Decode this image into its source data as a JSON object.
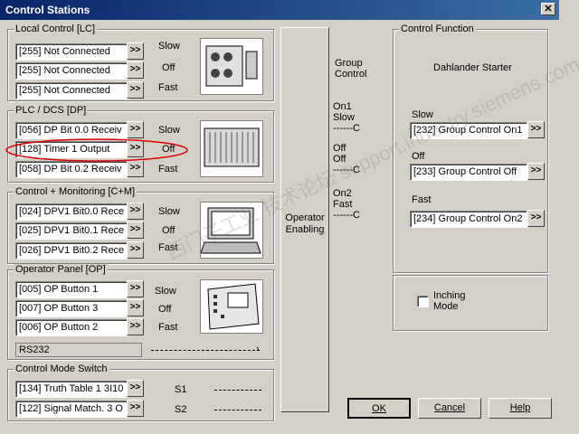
{
  "window": {
    "title": "Control Stations",
    "close": "✕"
  },
  "local": {
    "legend": "Local Control [LC]",
    "fields": [
      "[255] Not Connected",
      "[255] Not Connected",
      "[255] Not Connected"
    ],
    "labels": [
      "Slow",
      "Off",
      "Fast"
    ]
  },
  "plc": {
    "legend": "PLC / DCS [DP]",
    "fields": [
      "[056] DP Bit 0.0 Receiv",
      "[128] Timer 1 Output",
      "[058] DP Bit 0.2 Receiv"
    ],
    "labels": [
      "Slow",
      "Off",
      "Fast"
    ]
  },
  "cm": {
    "legend": "Control + Monitoring [C+M]",
    "fields": [
      "[024] DPV1 Bit0.0 Rece",
      "[025] DPV1 Bit0.1 Rece",
      "[026] DPV1 Bit0.2 Rece"
    ],
    "labels": [
      "Slow",
      "Off",
      "Fast"
    ]
  },
  "op": {
    "legend": "Operator Panel [OP]",
    "fields": [
      "[005] OP Button 1",
      "[007] OP Button 3",
      "[006] OP Button 2"
    ],
    "labels": [
      "Slow",
      "Off",
      "Fast"
    ],
    "rs232": "RS232"
  },
  "cms": {
    "legend": "Control Mode Switch",
    "fields": [
      "[134] Truth Table 1 3I10",
      "[122] Signal Match. 3 O"
    ],
    "labels": [
      "S1",
      "S2"
    ]
  },
  "browse": ">>",
  "operator_enabling": "Operator Enabling",
  "group_control": {
    "title": "Group Control",
    "on1_slow": "On1 Slow",
    "off": "Off Off",
    "on2_fast": "On2 Fast",
    "arrow_c": "------C"
  },
  "control_function": {
    "legend": "Control Function",
    "name": "Dahlander Starter",
    "slow_label": "Slow",
    "slow_value": "[232] Group Control On1",
    "off_label": "Off",
    "off_value": "[233] Group Control Off",
    "fast_label": "Fast",
    "fast_value": "[234] Group Control On2",
    "inching": "Inching Mode"
  },
  "buttons": {
    "ok": "OK",
    "cancel": "Cancel",
    "help": "Help"
  },
  "watermark": "西门子工业 技术论坛 support.industry.siemens.com/cs"
}
